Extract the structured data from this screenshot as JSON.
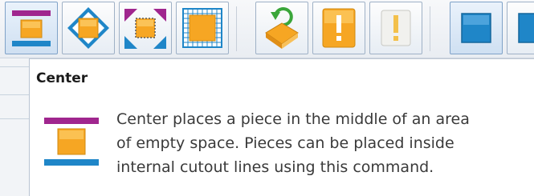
{
  "toolbar": {
    "buttons": [
      {
        "icon": "center-piece-icon",
        "active": true
      },
      {
        "icon": "fit-diamond-icon",
        "active": false
      },
      {
        "icon": "corner-cutout-icon",
        "active": false
      },
      {
        "icon": "grid-fill-icon",
        "active": false
      },
      {
        "icon": "rotate-piece-icon",
        "active": false
      },
      {
        "icon": "warning-active-icon",
        "active": false
      },
      {
        "icon": "warning-disabled-icon",
        "active": false
      },
      {
        "icon": "blue-square-icon",
        "active": false
      }
    ],
    "colors": {
      "purple": "#a0268e",
      "blue": "#1f86c8",
      "orange": "#f6a623",
      "orange_light": "#ffd77a"
    }
  },
  "tooltip": {
    "title": "Center",
    "icon": "center-piece-icon",
    "lines": [
      "Center places a piece in the middle of an area",
      "of empty space.  Pieces can be placed inside",
      "internal cutout lines using this command."
    ]
  }
}
